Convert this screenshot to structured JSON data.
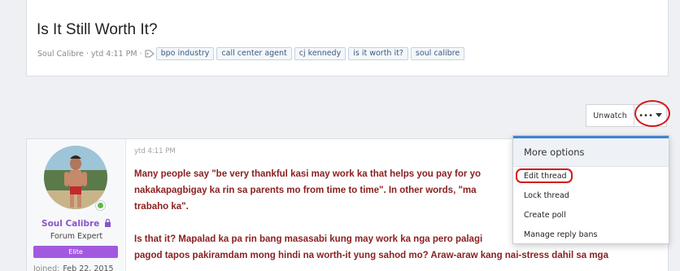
{
  "thread": {
    "title": "Is It Still Worth It?",
    "author": "Soul Calibre ·",
    "time": "ytd 4:11 PM ·",
    "tags": [
      "bpo industry",
      "call center agent",
      "cj kennedy",
      "is it worth it?",
      "soul calibre"
    ]
  },
  "actions": {
    "unwatch_label": "Unwatch",
    "more_label": "•••"
  },
  "dropdown": {
    "header": "More options",
    "items": [
      "Edit thread",
      "Lock thread",
      "Create poll",
      "Manage reply bans"
    ]
  },
  "post": {
    "time": "ytd 4:11 PM",
    "paragraphs": [
      "Many people say \"be very thankful kasi may work ka that helps you pay for yo",
      "nakakapagbigay ka rin sa parents mo from time to time\". In other words, \"ma",
      "trabaho ka\".",
      "Is that it? Mapalad ka pa rin bang masasabi kung may work ka nga pero palagi",
      "pagod tapos pakiramdam mong hindi na worth-it yung sahod mo? Araw-araw kang nai-stress dahil sa mga"
    ]
  },
  "user": {
    "name": "Soul Calibre",
    "title": "Forum Expert",
    "badge": "Elite",
    "joined_label": "Joined:",
    "joined_value": "Feb 22, 2015"
  },
  "colors": {
    "accent": "#3f83d1",
    "username": "#8a55c8",
    "badge": "#a259e0",
    "post_text": "#8b2020",
    "highlight": "#d41a1a"
  }
}
